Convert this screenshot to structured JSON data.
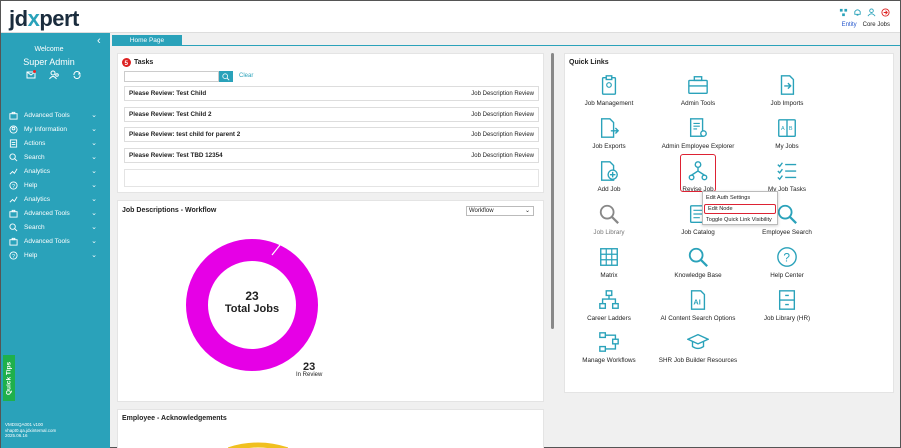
{
  "header": {
    "logo_prefix": "jd",
    "logo_x": "x",
    "logo_suffix": "pert",
    "links": {
      "entity": "Entity",
      "core_jobs": "Core Jobs"
    }
  },
  "sidebar": {
    "welcome": "Welcome",
    "user_name": "Super Admin",
    "items": [
      {
        "label": "Advanced Tools",
        "icon": "briefcase-icon"
      },
      {
        "label": "My Information",
        "icon": "user-circle-icon"
      },
      {
        "label": "Actions",
        "icon": "checklist-icon"
      },
      {
        "label": "Search",
        "icon": "search-icon"
      },
      {
        "label": "Analytics",
        "icon": "chart-icon"
      },
      {
        "label": "Help",
        "icon": "help-icon"
      },
      {
        "label": "Analytics",
        "icon": "chart-icon"
      },
      {
        "label": "Advanced Tools",
        "icon": "briefcase-icon"
      },
      {
        "label": "Search",
        "icon": "search-icon"
      },
      {
        "label": "Advanced Tools",
        "icon": "briefcase-icon"
      },
      {
        "label": "Help",
        "icon": "help-icon"
      }
    ],
    "quick_tips": "Quick Tips",
    "version_lines": [
      "VMDSQA001 v100",
      "vhapt0.qa.jdxinternal.com",
      "2025.06.16"
    ]
  },
  "tabs": {
    "home": "Home Page"
  },
  "tasks": {
    "title": "Tasks",
    "badge": "5",
    "search_placeholder": "",
    "clear_label": "Clear",
    "rows": [
      {
        "title": "Please Review: Test Child",
        "kind": "Job Description Review"
      },
      {
        "title": "Please Review: Test Child 2",
        "kind": "Job Description Review"
      },
      {
        "title": "Please Review: test child for parent 2",
        "kind": "Job Description Review"
      },
      {
        "title": "Please Review: Test TBD 12354",
        "kind": "Job Description Review"
      }
    ]
  },
  "workflow": {
    "title": "Job Descriptions - Workflow",
    "select_value": "Workflow",
    "total": "23",
    "total_label": "Total Jobs",
    "review_count": "23",
    "review_label": "In Review",
    "ring_color": "#e600e6"
  },
  "acknowledgements": {
    "title": "Employee - Acknowledgements"
  },
  "quick_links": {
    "title": "Quick Links",
    "items": [
      {
        "label": "Job Management",
        "icon": "clipboard-icon"
      },
      {
        "label": "Admin Tools",
        "icon": "toolbox-icon"
      },
      {
        "label": "Job Imports",
        "icon": "file-import-icon"
      },
      {
        "label": "Job Exports",
        "icon": "file-export-icon"
      },
      {
        "label": "Admin Employee Explorer",
        "icon": "document-gear-icon"
      },
      {
        "label": "My Jobs",
        "icon": "book-icon"
      },
      {
        "label": "Add Job",
        "icon": "file-add-icon"
      },
      {
        "label": "Revise Job",
        "icon": "hierarchy-icon"
      },
      {
        "label": "My Job Tasks",
        "icon": "task-list-icon"
      },
      {
        "label": "Job Library",
        "icon": "search-icon"
      },
      {
        "label": "Job Catalog",
        "icon": "catalog-icon"
      },
      {
        "label": "Employee Search",
        "icon": "search-icon"
      },
      {
        "label": "Matrix",
        "icon": "grid-icon"
      },
      {
        "label": "Knowledge Base",
        "icon": "search-icon"
      },
      {
        "label": "Help Center",
        "icon": "help-icon"
      },
      {
        "label": "Career Ladders",
        "icon": "org-chart-icon"
      },
      {
        "label": "AI Content Search Options",
        "icon": "ai-document-icon"
      },
      {
        "label": "Job Library (HR)",
        "icon": "cabinet-icon"
      },
      {
        "label": "Manage Workflows",
        "icon": "workflow-icon"
      },
      {
        "label": "SHR Job Builder Resources",
        "icon": "graduation-cap-icon"
      }
    ]
  },
  "context_menu": {
    "items": [
      "Edit Auth Settings",
      "Edit Node",
      "Toggle Quick Link Visibility"
    ],
    "active_index": 1
  },
  "colors": {
    "teal": "#2aa2ba",
    "magenta": "#e600e6",
    "quick_tips": "#1fb04b"
  }
}
